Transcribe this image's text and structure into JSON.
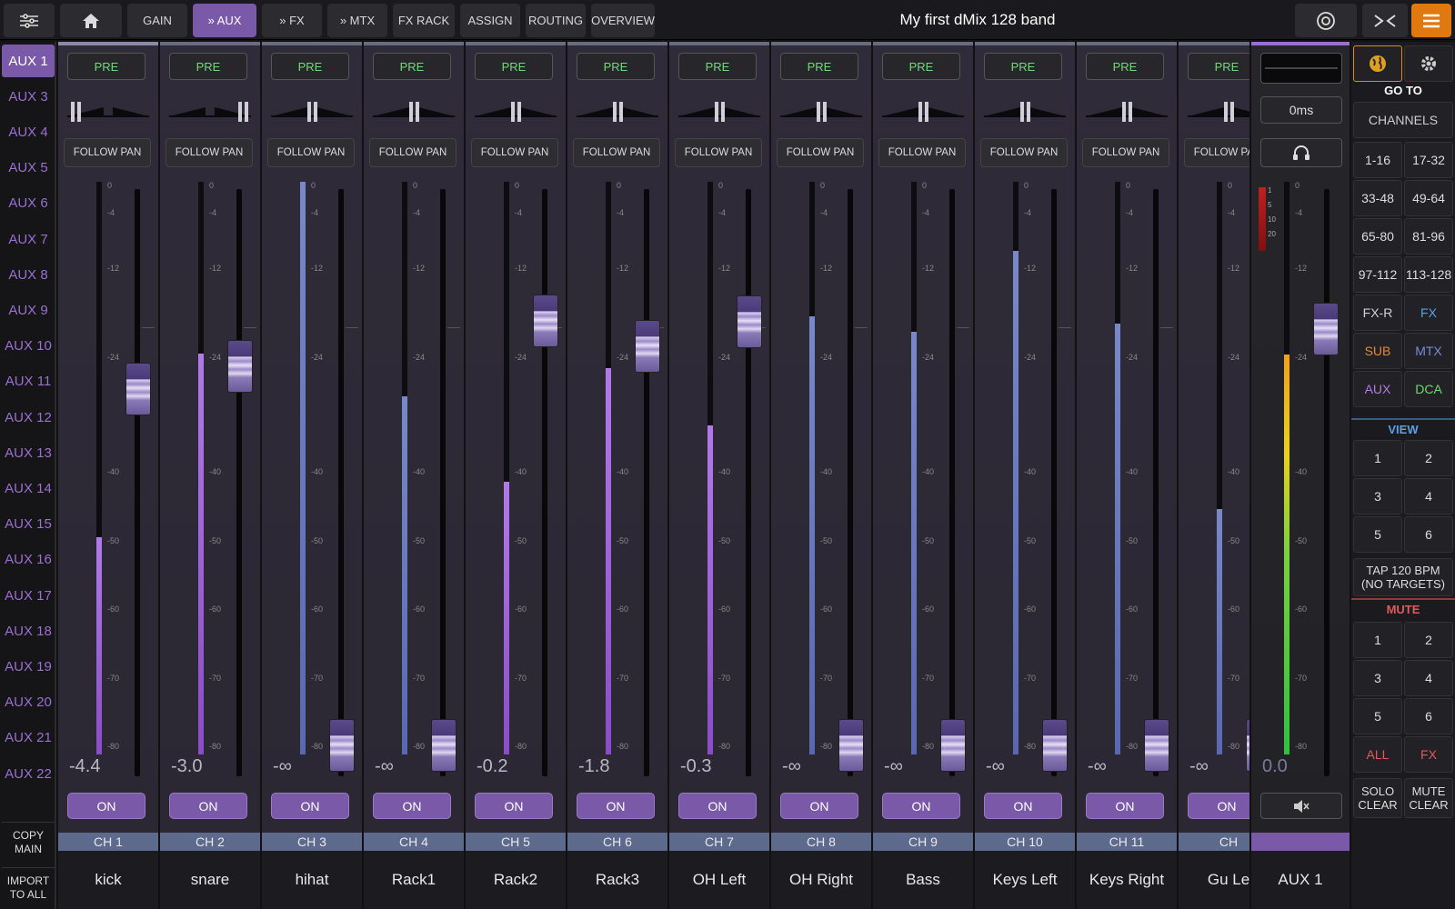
{
  "top": {
    "gain_tab": "GAIN",
    "aux_tab": "» AUX",
    "fx_tab": "» FX",
    "mtx_tab": "» MTX",
    "fxrack_tab": "FX RACK",
    "assign_tab": "ASSIGN",
    "routing_tab": "ROUTING",
    "overview_tab": "OVERVIEW",
    "title": "My first dMix 128 band"
  },
  "aux_list": [
    "AUX 1",
    "AUX 3",
    "AUX 4",
    "AUX 5",
    "AUX 6",
    "AUX 7",
    "AUX 8",
    "AUX 9",
    "AUX 10",
    "AUX 11",
    "AUX 12",
    "AUX 13",
    "AUX 14",
    "AUX 15",
    "AUX 16",
    "AUX 17",
    "AUX 18",
    "AUX 19",
    "AUX 20",
    "AUX 21",
    "AUX 22"
  ],
  "aux_buttons": {
    "copy": "COPY MAIN",
    "import": "IMPORT TO ALL"
  },
  "strip_labels": {
    "pre": "PRE",
    "follow_pan": "FOLLOW PAN",
    "on": "ON"
  },
  "scale_ticks": [
    "0",
    "-4",
    "-12",
    "-24",
    "-40",
    "-50",
    "-60",
    "-70",
    "-80"
  ],
  "channels": [
    {
      "ch": "CH 1",
      "name": "kick",
      "gain": "-4.4",
      "send_db": -4.4,
      "meter_db": -50,
      "pan": "left"
    },
    {
      "ch": "CH 2",
      "name": "snare",
      "gain": "-3.0",
      "send_db": -3.0,
      "meter_db": -24,
      "pan": "right"
    },
    {
      "ch": "CH 3",
      "name": "hihat",
      "gain": "-∞",
      "send_db": null,
      "meter_db": 0,
      "pan": "center"
    },
    {
      "ch": "CH 4",
      "name": "Rack1",
      "gain": "-∞",
      "send_db": null,
      "meter_db": -30,
      "pan": "center"
    },
    {
      "ch": "CH 5",
      "name": "Rack2",
      "gain": "-0.2",
      "send_db": -0.2,
      "meter_db": -42,
      "pan": "center"
    },
    {
      "ch": "CH 6",
      "name": "Rack3",
      "gain": "-1.8",
      "send_db": -1.8,
      "meter_db": -26,
      "pan": "center"
    },
    {
      "ch": "CH 7",
      "name": "OH Left",
      "gain": "-0.3",
      "send_db": -0.3,
      "meter_db": -34,
      "pan": "center"
    },
    {
      "ch": "CH 8",
      "name": "OH Right",
      "gain": "-∞",
      "send_db": null,
      "meter_db": -19,
      "pan": "center"
    },
    {
      "ch": "CH 9",
      "name": "Bass",
      "gain": "-∞",
      "send_db": null,
      "meter_db": -21,
      "pan": "center"
    },
    {
      "ch": "CH 10",
      "name": "Keys Left",
      "gain": "-∞",
      "send_db": null,
      "meter_db": -10,
      "pan": "center"
    },
    {
      "ch": "CH 11",
      "name": "Keys Right",
      "gain": "-∞",
      "send_db": null,
      "meter_db": -20,
      "pan": "center"
    },
    {
      "ch": "CH",
      "name": "Gu Le",
      "gain": "-∞",
      "send_db": null,
      "meter_db": -46,
      "pan": "center"
    }
  ],
  "master": {
    "delay": "0ms",
    "gain": "0.0",
    "name": "AUX 1"
  },
  "right": {
    "goto": "GO TO",
    "channels": "CHANNELS",
    "ranges": [
      "1-16",
      "17-32",
      "33-48",
      "49-64",
      "65-80",
      "81-96",
      "97-112",
      "113-128"
    ],
    "groups": [
      {
        "label": "FX-R",
        "color": "#cfcfd8"
      },
      {
        "label": "FX",
        "color": "#5aa0e8"
      },
      {
        "label": "SUB",
        "color": "#e08a3a"
      },
      {
        "label": "MTX",
        "color": "#7a8ad8"
      },
      {
        "label": "AUX",
        "color": "#b07ae0"
      },
      {
        "label": "DCA",
        "color": "#6adc6a"
      }
    ],
    "view": "VIEW",
    "view_buttons": [
      "1",
      "2",
      "3",
      "4",
      "5",
      "6"
    ],
    "tap": "TAP 120 BPM (NO TARGETS)",
    "mute": "MUTE",
    "mute_buttons": [
      "1",
      "2",
      "3",
      "4",
      "5",
      "6"
    ],
    "all": "ALL",
    "fx": "FX",
    "solo_clear": "SOLO CLEAR",
    "mute_clear": "MUTE CLEAR"
  },
  "colors": {
    "accent": "#7a5aa8",
    "aux_text": "#9a6fd0",
    "pre_green": "#6fdc6f",
    "mute_red": "#e05a5a",
    "view_blue": "#5aa0e8"
  }
}
